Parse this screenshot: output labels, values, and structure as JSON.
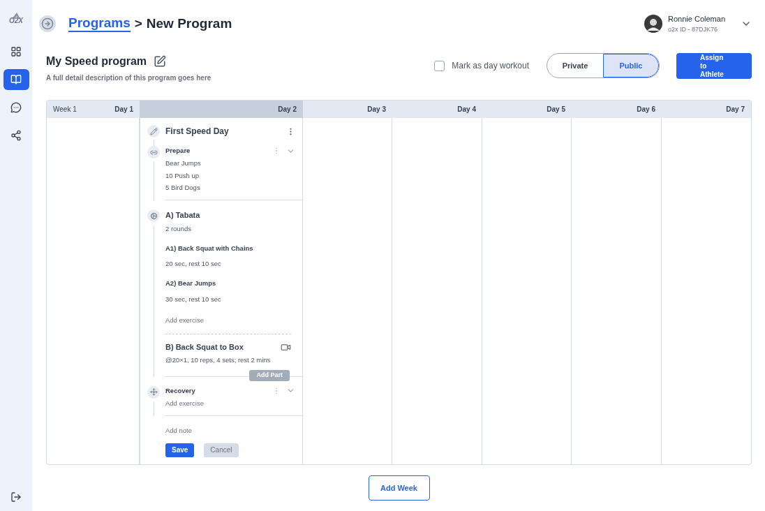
{
  "logo": {
    "text": "O2X"
  },
  "sidebar": {
    "items": [
      {
        "kind": "grid",
        "selected": false
      },
      {
        "kind": "book",
        "selected": true
      },
      {
        "kind": "chat",
        "selected": false
      },
      {
        "kind": "share",
        "selected": false
      }
    ]
  },
  "breadcrumb": {
    "link": "Programs",
    "separator": ">",
    "current": "New Program"
  },
  "user": {
    "name": "Ronnie Coleman",
    "id": "o2x ID - 87DJK76"
  },
  "program": {
    "title": "My Speed program",
    "description": "A full detail description of this program goes here"
  },
  "day_workout": {
    "label": "Mark as day workout",
    "checked": false
  },
  "visibility": [
    {
      "label": "Private",
      "selected": false
    },
    {
      "label": "Public",
      "selected": true
    }
  ],
  "assign_button": "Assign to Athlete",
  "week": {
    "label": "Week 1",
    "days": [
      {
        "label": "Day 1",
        "selected": false
      },
      {
        "label": "Day 2",
        "selected": true
      },
      {
        "label": "Day 3",
        "selected": false
      },
      {
        "label": "Day 4",
        "selected": false
      },
      {
        "label": "Day 5",
        "selected": false
      },
      {
        "label": "Day 6",
        "selected": false
      },
      {
        "label": "Day 7",
        "selected": false
      }
    ]
  },
  "workout": {
    "title": "First Speed Day",
    "parts": [
      {
        "kind": "block",
        "title": "Prepare",
        "lines": [
          "Bear Jumps",
          "10 Push up",
          "5 Bird Dogs"
        ]
      },
      {
        "kind": "group",
        "title": "A) Tabata",
        "subtitle": "2 rounds",
        "exercises": [
          {
            "name": "A1) Back Squat with Chains",
            "detail": "20 sec, rest 10 sec"
          },
          {
            "name": "A2) Bear Jumps",
            "detail": "30 sec, rest 10 sec"
          }
        ],
        "add": "Add exercise",
        "next": {
          "title": "B) Back Squat to Box",
          "detail": "@20×1, 10 reps, 4 sets; rest 2 mins"
        },
        "add_part": "Add Part"
      },
      {
        "kind": "empty",
        "title": "Recovery",
        "add": "Add exercise"
      }
    ],
    "note": "Add note",
    "save": "Save",
    "cancel": "Cancel"
  },
  "add_week": "Add Week"
}
